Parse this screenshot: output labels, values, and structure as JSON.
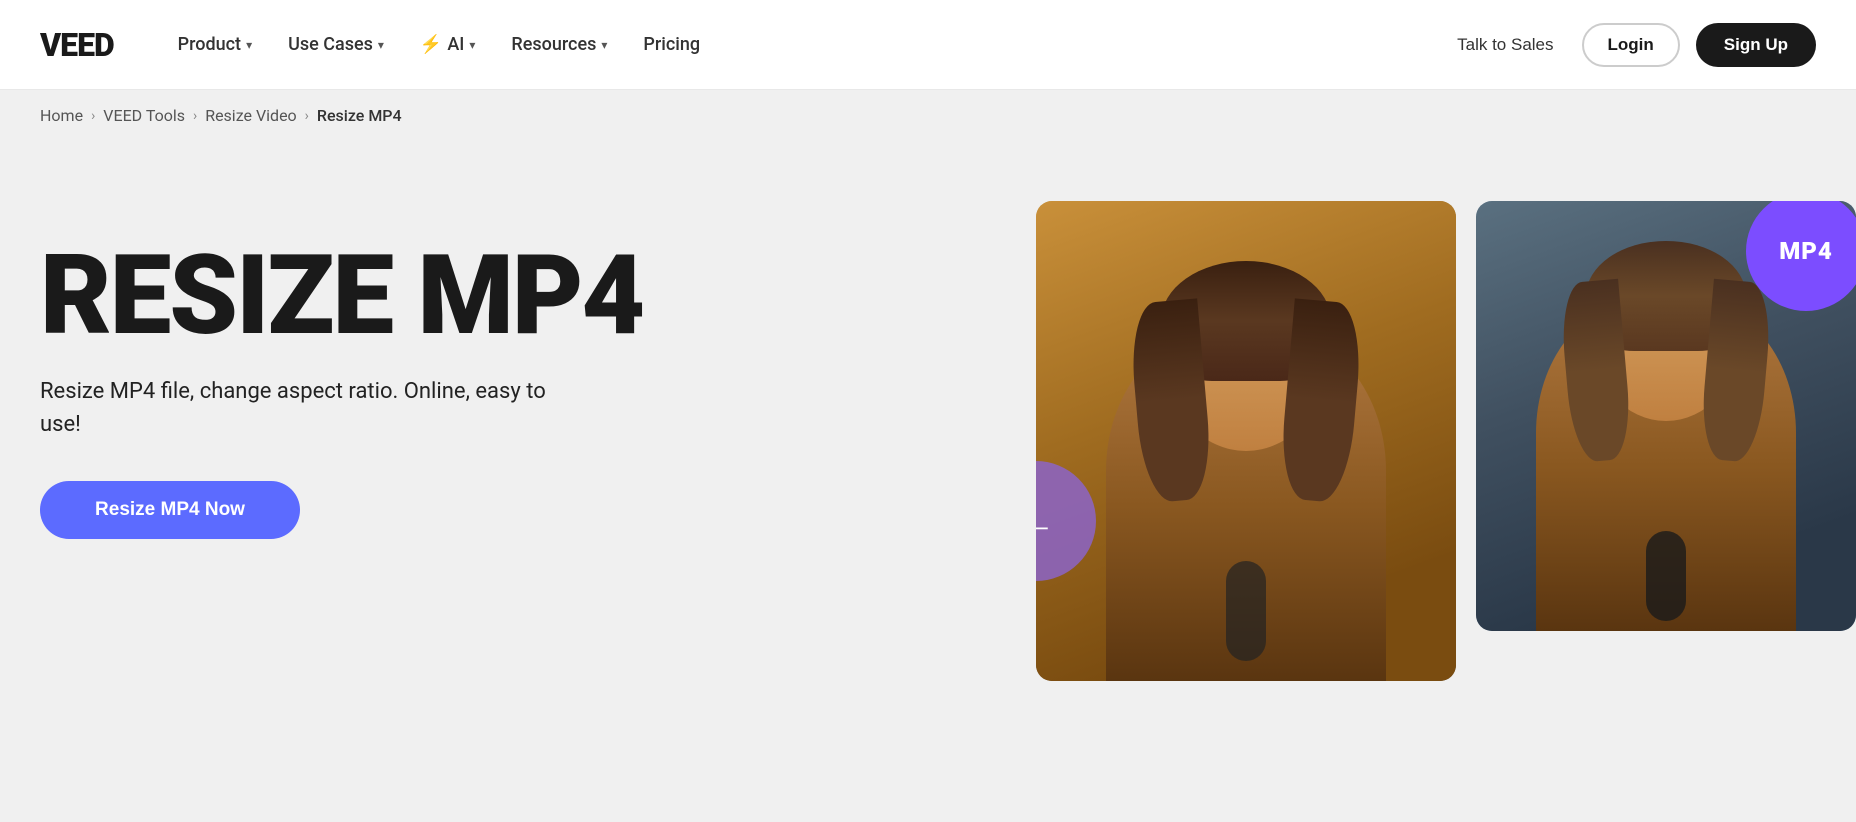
{
  "brand": {
    "logo": "VEED"
  },
  "navbar": {
    "items": [
      {
        "label": "Product",
        "hasChevron": true,
        "hasAiIcon": false
      },
      {
        "label": "Use Cases",
        "hasChevron": true,
        "hasAiIcon": false
      },
      {
        "label": "AI",
        "hasChevron": true,
        "hasAiIcon": true
      },
      {
        "label": "Resources",
        "hasChevron": true,
        "hasAiIcon": false
      },
      {
        "label": "Pricing",
        "hasChevron": false,
        "hasAiIcon": false
      }
    ],
    "talk_to_sales": "Talk to Sales",
    "login": "Login",
    "signup": "Sign Up"
  },
  "breadcrumb": {
    "items": [
      {
        "label": "Home"
      },
      {
        "label": "VEED Tools"
      },
      {
        "label": "Resize Video"
      },
      {
        "label": "Resize MP4"
      }
    ]
  },
  "hero": {
    "title": "RESIZE MP4",
    "subtitle": "Resize MP4 file, change aspect ratio. Online, easy to use!",
    "cta_label": "Resize MP4 Now",
    "mp4_badge": "MP4",
    "arrow": "←"
  },
  "colors": {
    "accent_purple": "#7c4dff",
    "accent_blue": "#5c6bff",
    "dark": "#1a1a1a",
    "bg": "#f0f0f0"
  }
}
